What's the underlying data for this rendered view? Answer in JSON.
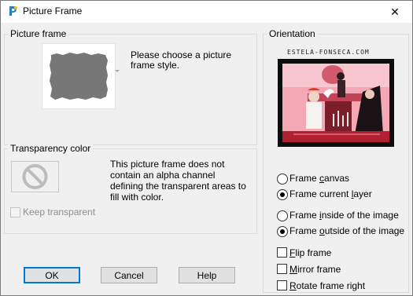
{
  "window": {
    "title": "Picture Frame",
    "close_symbol": "✕"
  },
  "picture_frame_group": {
    "title": "Picture frame",
    "prompt_line1": "Please choose a picture",
    "prompt_line2": "frame style."
  },
  "transparency_group": {
    "title": "Transparency color",
    "message_lines": [
      "This picture frame does not",
      "contain an alpha channel",
      "defining the transparent areas to",
      "fill with color."
    ],
    "keep_transparent_label": "Keep transparent",
    "keep_transparent_checked": false,
    "keep_transparent_enabled": false
  },
  "orientation_group": {
    "title": "Orientation",
    "watermark": "ESTELA-FONSECA.COM",
    "frame_target_options": [
      "Frame canvas",
      "Frame current layer"
    ],
    "frame_target_selected": "Frame current layer",
    "frame_position_options": [
      "Frame inside of the image",
      "Frame outside of the image"
    ],
    "frame_position_selected": "Frame outside of the image",
    "flip_frame_label": "Flip frame",
    "mirror_frame_label": "Mirror frame",
    "rotate_frame_label": "Rotate frame right",
    "flip_frame_checked": false,
    "mirror_frame_checked": false,
    "rotate_frame_checked": false
  },
  "buttons": {
    "ok": "OK",
    "cancel": "Cancel",
    "help": "Help"
  },
  "colors": {
    "default_button_border": "#0078d7",
    "preview_frame": "#0d0d0d",
    "preview_background": "#f4a8b6",
    "frame_thumbnail": "#777777"
  }
}
